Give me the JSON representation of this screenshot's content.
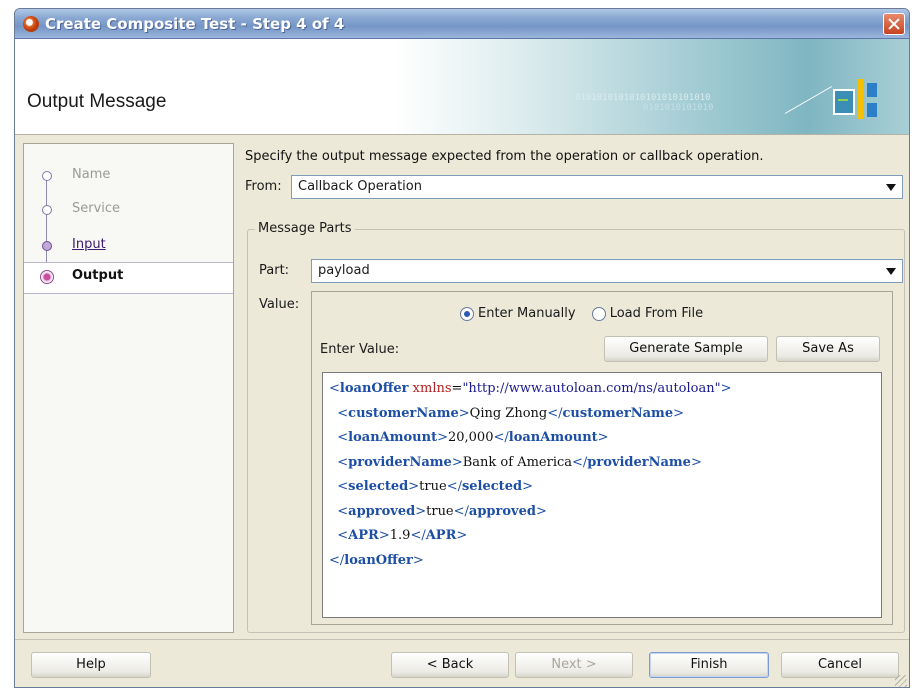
{
  "window": {
    "title": "Create Composite Test - Step 4 of 4",
    "header_title": "Output Message",
    "banner_binary_1": "0101010101010101010101010",
    "banner_binary_2": "0101010101010"
  },
  "steps": [
    {
      "label": "Name",
      "state": "disabled"
    },
    {
      "label": "Service",
      "state": "disabled"
    },
    {
      "label": "Input",
      "state": "visited"
    },
    {
      "label": "Output",
      "state": "current"
    }
  ],
  "main": {
    "instruction": "Specify the output message expected from the operation or callback operation.",
    "from_label": "From:",
    "from_value": "Callback Operation",
    "message_parts_title": "Message Parts",
    "part_label": "Part:",
    "part_value": "payload",
    "value_label": "Value:",
    "radio_manual": "Enter Manually",
    "radio_file": "Load From File",
    "selected_mode": "Enter Manually",
    "enter_value_label": "Enter Value:",
    "generate_sample_button": "Generate Sample",
    "save_as_button": "Save As"
  },
  "xml": {
    "root_tag": "loanOffer",
    "xmlns_attr": "xmlns",
    "xmlns_value": "\"http://www.autoloan.com/ns/autoloan\"",
    "fields": [
      {
        "tag": "customerName",
        "value": "Qing Zhong"
      },
      {
        "tag": "loanAmount",
        "value": "20,000"
      },
      {
        "tag": "providerName",
        "value": "Bank of America"
      },
      {
        "tag": "selected",
        "value": "true"
      },
      {
        "tag": "approved",
        "value": "true"
      },
      {
        "tag": "APR",
        "value": "1.9"
      }
    ]
  },
  "footer": {
    "help_button": "Help",
    "back_button": "< Back",
    "next_button": "Next >",
    "finish_button": "Finish",
    "cancel_button": "Cancel"
  },
  "colors": {
    "xml_tag": "#1c4ea5",
    "xml_attr": "#b22222",
    "current_step_marker": "#c84f9f"
  }
}
